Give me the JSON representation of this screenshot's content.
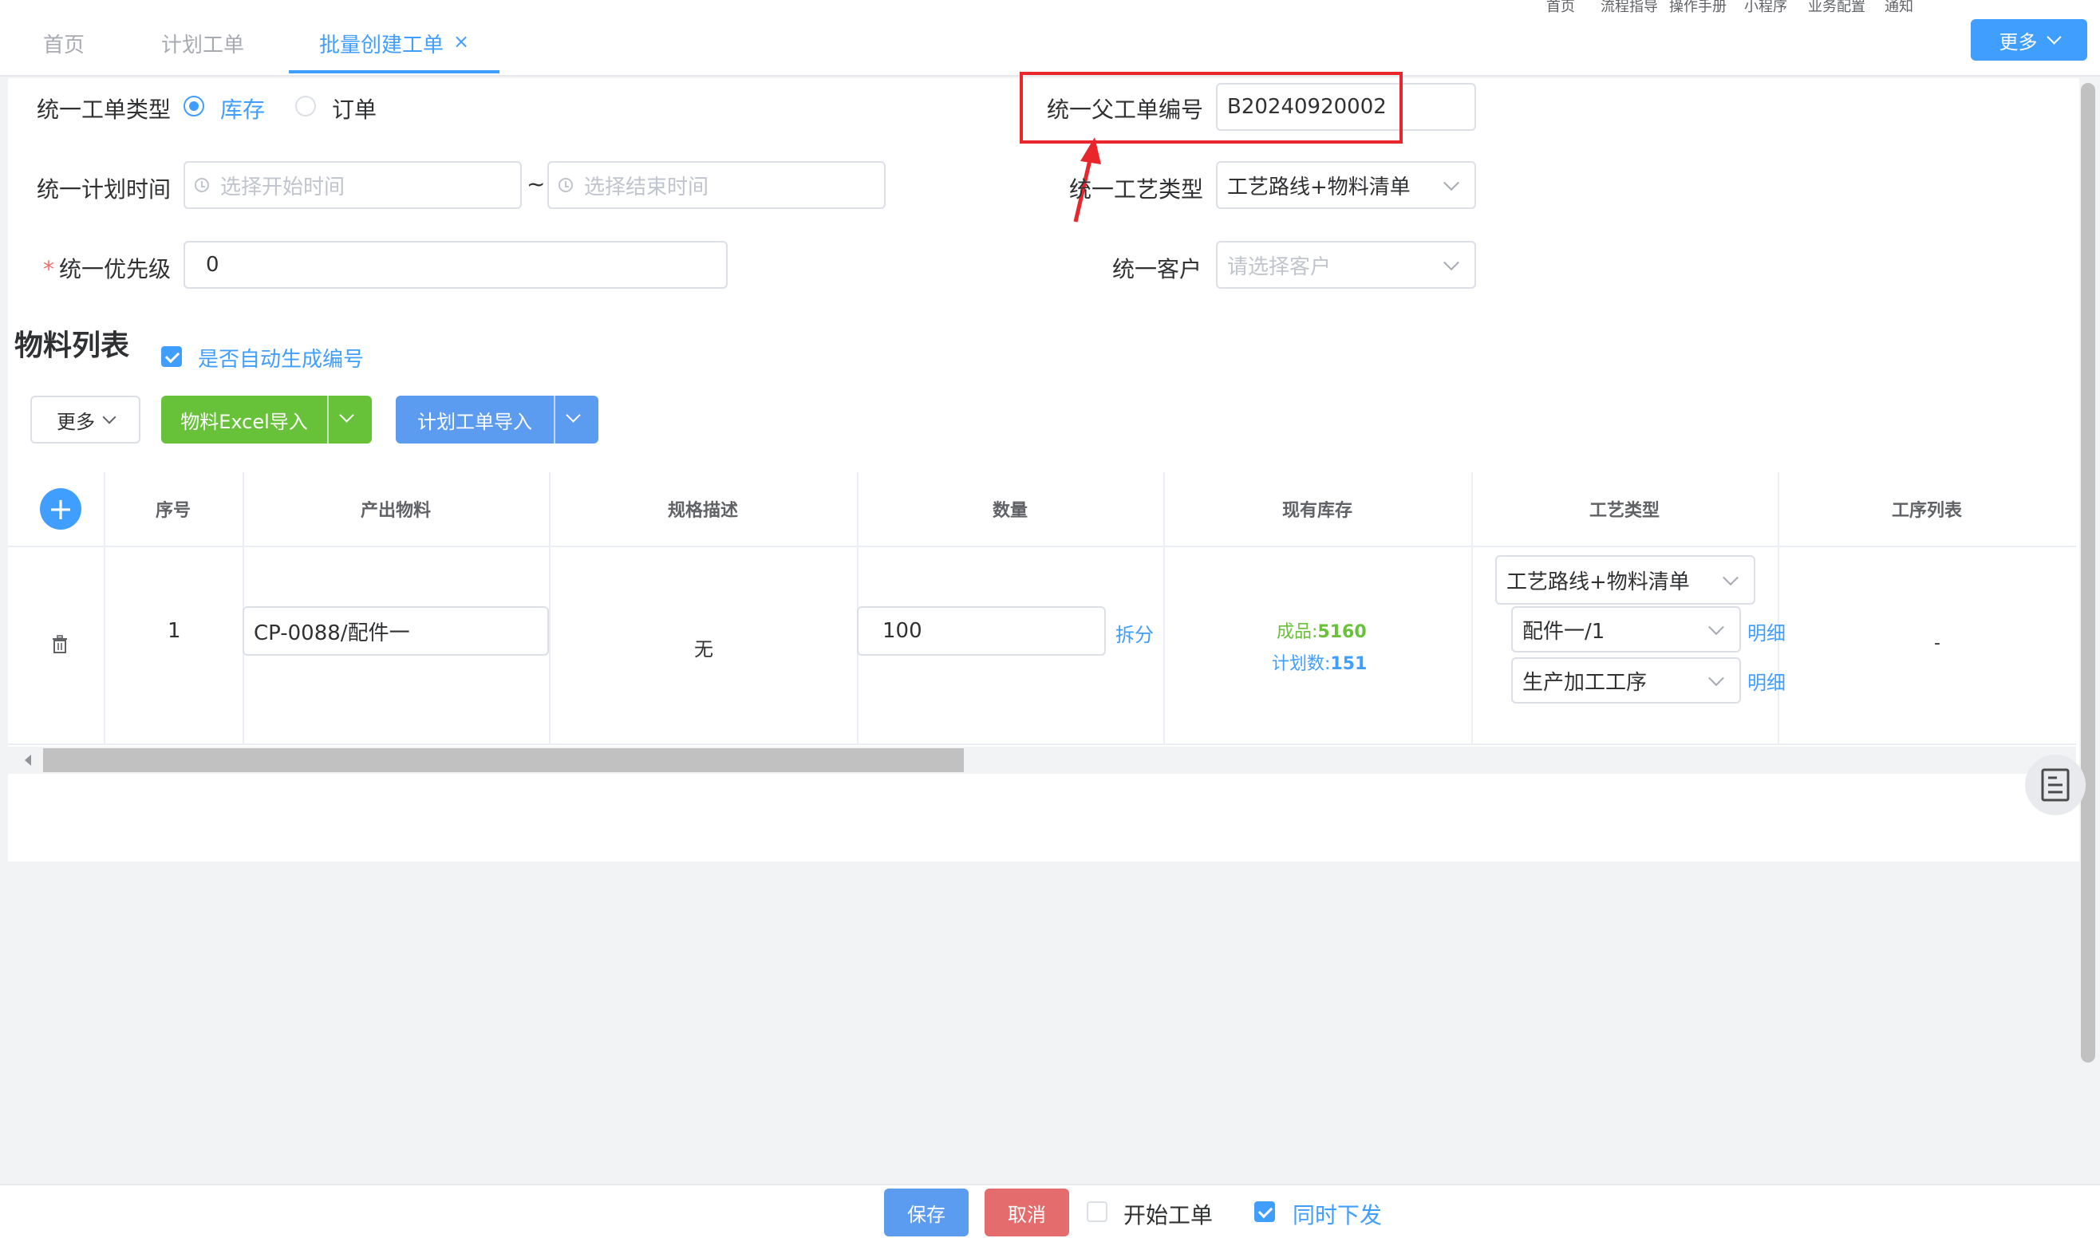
{
  "top_links": [
    "首页",
    "流程指导",
    "操作手册",
    "小程序",
    "业务配置",
    "通知"
  ],
  "tabs": [
    {
      "label": "首页"
    },
    {
      "label": "计划工单"
    },
    {
      "label": "批量创建工单",
      "active": true
    }
  ],
  "header_more_label": "更多",
  "form": {
    "order_type_label": "统一工单类型",
    "order_type_options": [
      {
        "label": "库存",
        "checked": true
      },
      {
        "label": "订单",
        "checked": false
      }
    ],
    "parent_order_label": "统一父工单编号",
    "parent_order_value": "B20240920002",
    "plan_time_label": "统一计划时间",
    "start_placeholder": "选择开始时间",
    "end_placeholder": "选择结束时间",
    "range_separator": "~",
    "process_type_label": "统一工艺类型",
    "process_type_value": "工艺路线+物料清单",
    "priority_required_mark": "*",
    "priority_label": "统一优先级",
    "priority_value": "0",
    "customer_label": "统一客户",
    "customer_placeholder": "请选择客户"
  },
  "materials": {
    "title": "物料列表",
    "auto_number_label": "是否自动生成编号",
    "auto_number_checked": true,
    "more_label": "更多",
    "excel_import_label": "物料Excel导入",
    "plan_import_label": "计划工单导入"
  },
  "table": {
    "add_button": "+",
    "columns": [
      "序号",
      "产出物料",
      "规格描述",
      "数量",
      "现有库存",
      "工艺类型",
      "工序列表"
    ],
    "rows": [
      {
        "index": "1",
        "material": "CP-0088/配件一",
        "spec": "无",
        "quantity": "100",
        "split_label": "拆分",
        "stock_finished_label": "成品:",
        "stock_finished_value": "5160",
        "stock_planned_label": "计划数:",
        "stock_planned_value": "151",
        "process_type": "工艺路线+物料清单",
        "bom": "配件一/1",
        "bom_detail_label": "明细",
        "route": "生产加工工序",
        "route_detail_label": "明细",
        "operations": "-"
      }
    ]
  },
  "footer": {
    "save_label": "保存",
    "cancel_label": "取消",
    "start_order_label": "开始工单",
    "start_order_checked": false,
    "dispatch_label": "同时下发",
    "dispatch_checked": true
  },
  "colors": {
    "primary": "#409eff",
    "success": "#67c23a",
    "danger": "#f56c6c",
    "annotation": "#e8262b"
  }
}
